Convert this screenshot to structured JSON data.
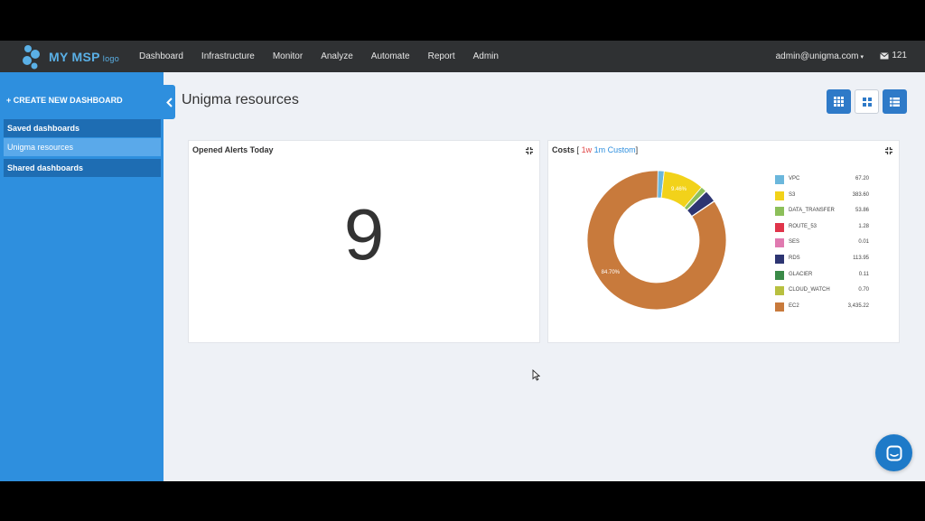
{
  "brand": {
    "name": "MY MSP",
    "sub": "logo",
    "color": "#5ab0e6"
  },
  "nav": {
    "items": [
      "Dashboard",
      "Infrastructure",
      "Monitor",
      "Analyze",
      "Automate",
      "Report",
      "Admin"
    ]
  },
  "user": {
    "email": "admin@unigma.com",
    "caret": "▾"
  },
  "messages": {
    "count": "121"
  },
  "sidebar": {
    "create_label": "+ CREATE NEW DASHBOARD",
    "saved_header": "Saved dashboards",
    "saved_items": [
      "Unigma resources"
    ],
    "shared_header": "Shared dashboards"
  },
  "page": {
    "title": "Unigma resources"
  },
  "alerts_panel": {
    "title": "Opened Alerts Today",
    "value": "9"
  },
  "costs_panel": {
    "title": "Costs",
    "range_open": "[",
    "range_1w": "1w",
    "range_1m": "1m",
    "range_custom": "Custom",
    "range_close": "]"
  },
  "chart_data": {
    "type": "pie",
    "categories": [
      "VPC",
      "S3",
      "DATA_TRANSFER",
      "ROUTE_53",
      "SES",
      "RDS",
      "GLACIER",
      "CLOUD_WATCH",
      "EC2"
    ],
    "values": [
      67.2,
      383.6,
      53.86,
      1.28,
      0.01,
      113.95,
      0.11,
      0.7,
      3435.22
    ],
    "value_labels": [
      "67.20",
      "383.60",
      "53.86",
      "1.28",
      "0.01",
      "113.95",
      "0.11",
      "0.70",
      "3,435.22"
    ],
    "colors": [
      "#6bb7dc",
      "#f2d21a",
      "#8cbf5a",
      "#e0344a",
      "#e07ab0",
      "#2d3572",
      "#3a8a48",
      "#b8c040",
      "#c87a3c"
    ],
    "slice_labels": {
      "S3": "9.46%",
      "EC2": "84.70%"
    },
    "legend": "right",
    "donut": true
  }
}
